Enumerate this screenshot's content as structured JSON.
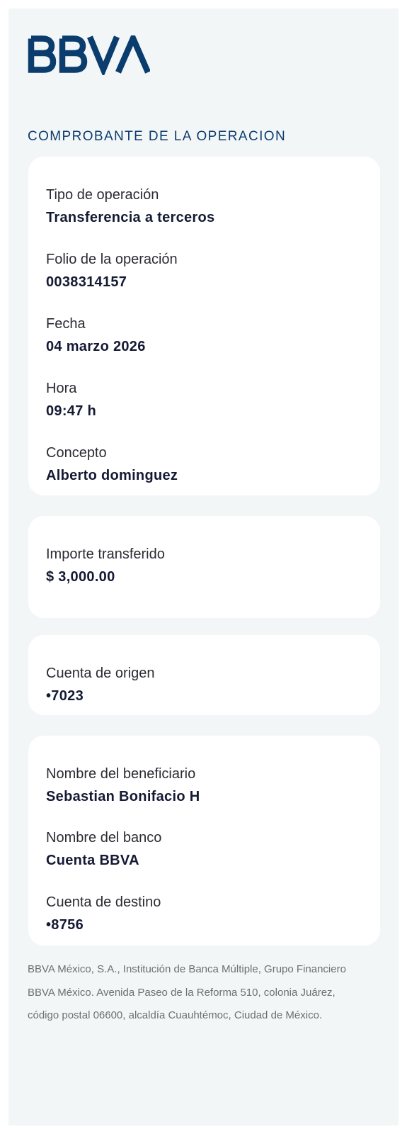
{
  "brand": {
    "logo_text": "BBVA",
    "color": "#0b3c6e"
  },
  "receipt": {
    "title": "COMPROBANTE DE LA OPERACION"
  },
  "operation_card": {
    "tipo_label": "Tipo de operación",
    "tipo_value": "Transferencia a terceros",
    "folio_label": "Folio de la operación",
    "folio_value": "0038314157",
    "fecha_label": "Fecha",
    "fecha_value": "04 marzo 2026",
    "hora_label": "Hora",
    "hora_value": "09:47 h",
    "concepto_label": "Concepto",
    "concepto_value": "Alberto dominguez"
  },
  "amount_card": {
    "label": "Importe transferido",
    "value": "$ 3,000.00"
  },
  "origin_card": {
    "label": "Cuenta de origen",
    "value": "•7023"
  },
  "beneficiary_card": {
    "nombre_label": "Nombre del beneficiario",
    "nombre_value": "Sebastian Bonifacio H",
    "banco_label": "Nombre del banco",
    "banco_value": "Cuenta BBVA",
    "destino_label": "Cuenta de destino",
    "destino_value": "•8756"
  },
  "footer": {
    "line1": "BBVA México, S.A., Institución de Banca Múltiple, Grupo Financiero",
    "line2": "BBVA México. Avenida Paseo de la Reforma 510, colonia Juárez,",
    "line3": "código postal 06600, alcaldía Cuauhtémoc, Ciudad de México."
  }
}
